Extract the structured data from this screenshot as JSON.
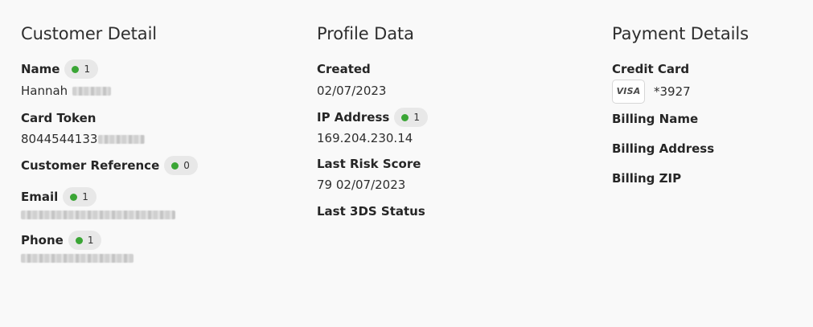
{
  "customer_detail": {
    "title": "Customer Detail",
    "name": {
      "label": "Name",
      "badge_count": "1",
      "value_visible": "Hannah"
    },
    "card_token": {
      "label": "Card Token",
      "value_visible": "8044544133"
    },
    "customer_reference": {
      "label": "Customer Reference",
      "badge_count": "0"
    },
    "email": {
      "label": "Email",
      "badge_count": "1"
    },
    "phone": {
      "label": "Phone",
      "badge_count": "1"
    }
  },
  "profile_data": {
    "title": "Profile Data",
    "created": {
      "label": "Created",
      "value": "02/07/2023"
    },
    "ip_address": {
      "label": "IP Address",
      "badge_count": "1",
      "value": "169.204.230.14"
    },
    "last_risk_score": {
      "label": "Last Risk Score",
      "value": "79 02/07/2023"
    },
    "last_3ds_status": {
      "label": "Last 3DS Status"
    }
  },
  "payment_details": {
    "title": "Payment Details",
    "credit_card": {
      "label": "Credit Card",
      "brand": "VISA",
      "last4": "*3927"
    },
    "billing_name": {
      "label": "Billing Name"
    },
    "billing_address": {
      "label": "Billing Address"
    },
    "billing_zip": {
      "label": "Billing ZIP"
    }
  },
  "colors": {
    "background": "#f9f9f9",
    "badge_background": "#e8e8e8",
    "status_dot": "#3aa535",
    "text": "#262626"
  }
}
